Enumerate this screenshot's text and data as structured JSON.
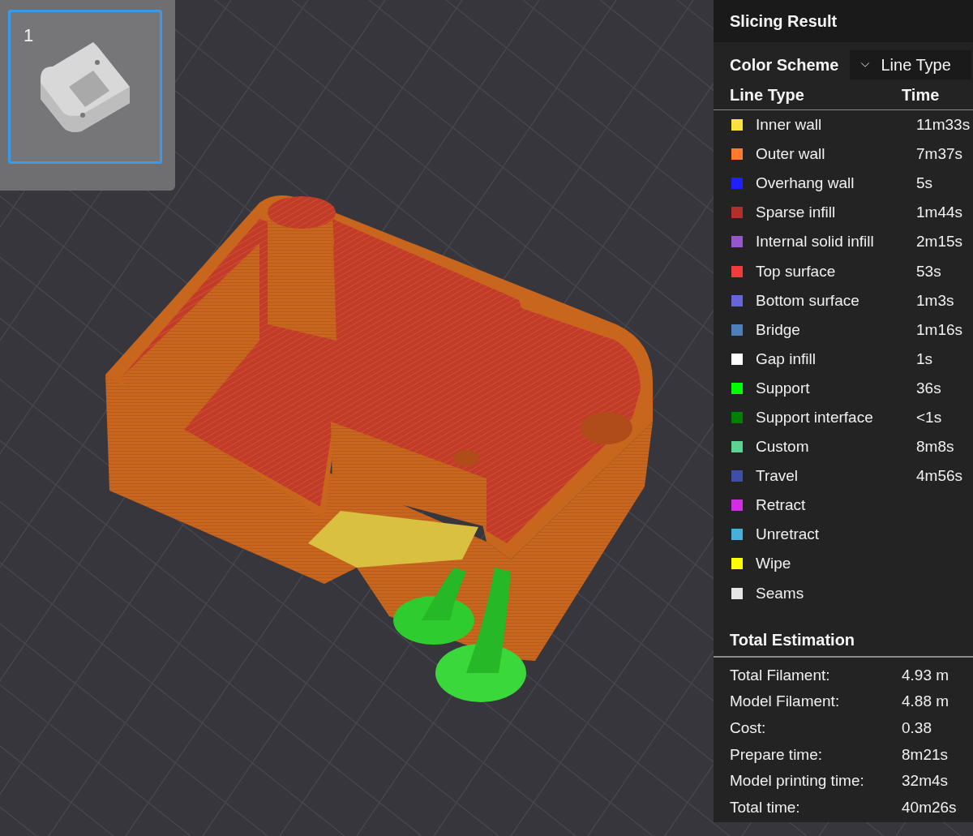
{
  "plate_thumbnail": {
    "label": "1",
    "selected": true
  },
  "slicing_result": {
    "title": "Slicing Result",
    "color_scheme": {
      "label": "Color Scheme",
      "value": "Line Type"
    },
    "columns": [
      "Line Type",
      "Time"
    ],
    "line_types": [
      {
        "name": "Inner wall",
        "time": "11m33s",
        "color": "#ffe03c"
      },
      {
        "name": "Outer wall",
        "time": "7m37s",
        "color": "#ff7a30"
      },
      {
        "name": "Overhang wall",
        "time": "5s",
        "color": "#1f1fff"
      },
      {
        "name": "Sparse infill",
        "time": "1m44s",
        "color": "#b0302a"
      },
      {
        "name": "Internal solid infill",
        "time": "2m15s",
        "color": "#9657cc"
      },
      {
        "name": "Top surface",
        "time": "53s",
        "color": "#f03c3c"
      },
      {
        "name": "Bottom surface",
        "time": "1m3s",
        "color": "#6666d8"
      },
      {
        "name": "Bridge",
        "time": "1m16s",
        "color": "#4d80ba"
      },
      {
        "name": "Gap infill",
        "time": "1s",
        "color": "#ffffff"
      },
      {
        "name": "Support",
        "time": "36s",
        "color": "#00ff00"
      },
      {
        "name": "Support interface",
        "time": "<1s",
        "color": "#008000"
      },
      {
        "name": "Custom",
        "time": "8m8s",
        "color": "#5ed193"
      },
      {
        "name": "Travel",
        "time": "4m56s",
        "color": "#3f4fa6"
      },
      {
        "name": "Retract",
        "color": "#d02ee0"
      },
      {
        "name": "Unretract",
        "color": "#48b0d8"
      },
      {
        "name": "Wipe",
        "color": "#ffff00"
      },
      {
        "name": "Seams",
        "color": "#e6e6e6"
      }
    ],
    "total_estimation": {
      "title": "Total Estimation",
      "rows": [
        {
          "label": "Total Filament:",
          "value": "4.93 m"
        },
        {
          "label": "Model Filament:",
          "value": "4.88 m"
        },
        {
          "label": "Cost:",
          "value": "0.38"
        },
        {
          "label": "Prepare time:",
          "value": "8m21s"
        },
        {
          "label": "Model printing time:",
          "value": "32m4s"
        },
        {
          "label": "Total time:",
          "value": "40m26s"
        }
      ]
    }
  }
}
